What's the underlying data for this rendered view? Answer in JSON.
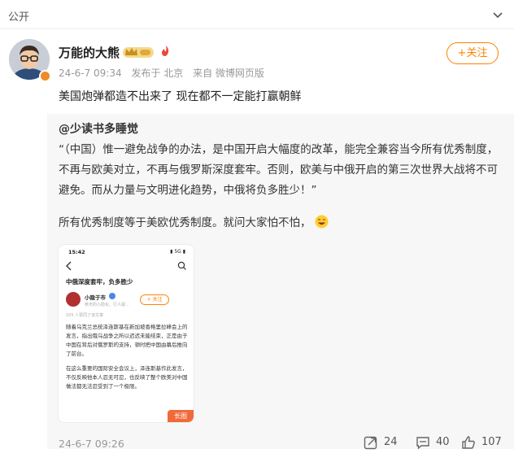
{
  "topbar": {
    "visibility_label": "公开",
    "menu_icon": "chevron-down-icon"
  },
  "post": {
    "author": "万能的大熊",
    "badges": [
      "vip-crown-icon",
      "hot-icon"
    ],
    "time": "24-6-7 09:34",
    "published_from": "发布于 北京",
    "source": "来自 微博网页版",
    "follow_label": "+关注",
    "text": "美国炮弹都造不出来了 现在都不一定能打赢朝鲜"
  },
  "repost": {
    "author": "@少读书多睡觉",
    "quote": "“（中国）惟一避免战争的办法，是中国开启大幅度的改革，能完全兼容当今所有优秀制度，不再与欧美对立，不再与俄罗斯深度套牢。否则，欧美与中俄开启的第三次世界大战将不可避免。而从力量与文明进化趋势，中俄将负多胜少！”",
    "comment": "所有优秀制度等于美欧优秀制度。就问大家怕不怕，",
    "emoji": "laugh-emoji-icon",
    "image": {
      "status_time": "15:42",
      "status_icons": "▮ 5G ▮",
      "title": "中俄深度套牢，负多胜少",
      "author": "小隐于市",
      "author_sub": "参天的小隐化、行人疑...",
      "follow_label": "+ 关注",
      "readers": "105 人赞同了该文章",
      "paragraphs": [
        "随着乌克兰总统泽连斯基在新加坡香格里拉峰会上的发言，指出俄乌战争之所以迟迟未能结束，正是由于中国在背后对俄罗斯的支持，顿时把中国由幕后推向了前台。",
        "在这么重要的国际安全会议上，泽连斯基作此发言，不仅反映他本人忍无可忍，也反映了整个欧美对中国做法都无法忍受到了一个极限。"
      ],
      "long_tag": "长图"
    },
    "time": "24-6-7 09:26",
    "repost_count": "24",
    "comment_count": "40",
    "like_count": "107"
  },
  "colors": {
    "accent": "#ff8200",
    "repost_bg": "#f7f7f7",
    "meta": "#999999"
  }
}
